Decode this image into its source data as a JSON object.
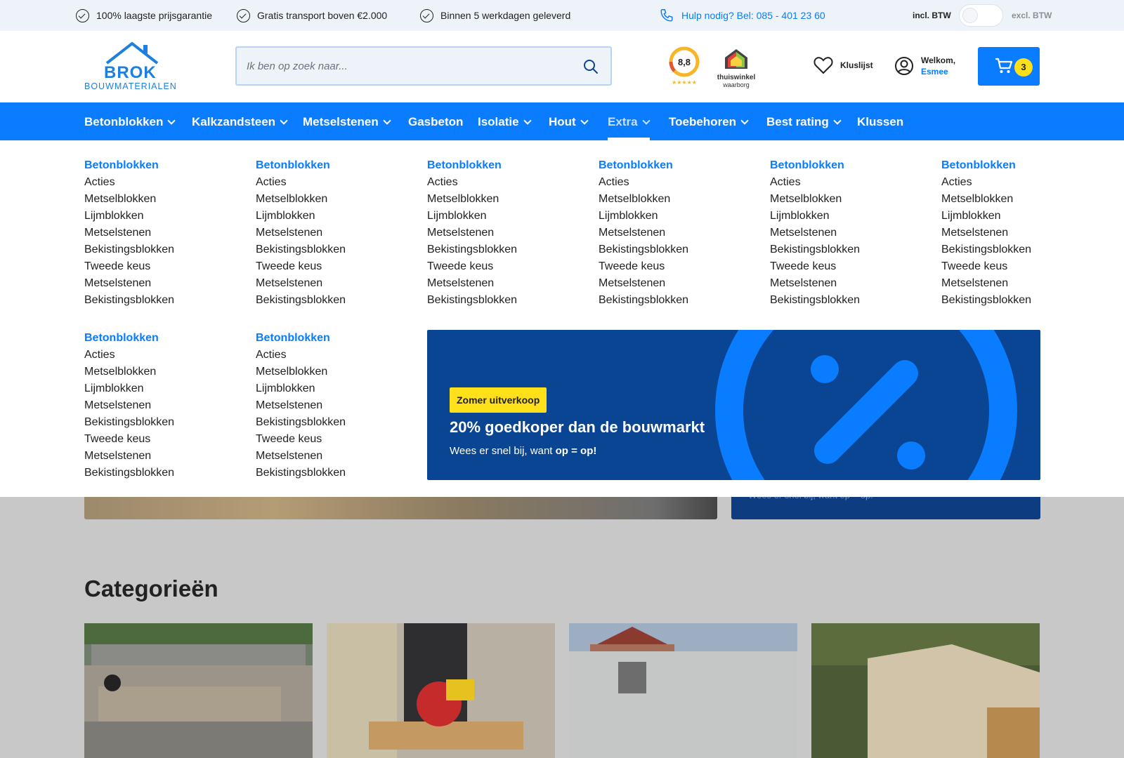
{
  "topbar": {
    "usps": [
      "100% laagste prijsgarantie",
      "Gratis transport boven €2.000",
      "Binnen 5 werkdagen geleverd"
    ],
    "help": "Hulp nodig? Bel: 085 - 401 23 60",
    "incl_btw": "incl. BTW",
    "excl_btw": "excl. BTW"
  },
  "header": {
    "logo_brand": "BROK",
    "logo_sub": "BOUWMATERIALEN",
    "search_placeholder": "Ik ben op zoek naar...",
    "rating": "8,8",
    "thuiswinkel_line1": "thuiswinkel",
    "thuiswinkel_line2": "waarborg",
    "wishlist": "Kluslijst",
    "welcome": "Welkom,",
    "user_name": "Esmee",
    "cart_count": "3"
  },
  "nav": {
    "items": [
      {
        "label": "Betonblokken"
      },
      {
        "label": "Kalkzandsteen"
      },
      {
        "label": "Metselstenen"
      },
      {
        "label": "Gasbeton"
      },
      {
        "label": "Isolatie"
      },
      {
        "label": "Hout"
      },
      {
        "label": "Extra"
      },
      {
        "label": "Toebehoren"
      },
      {
        "label": "Best rating"
      },
      {
        "label": "Klussen"
      }
    ]
  },
  "mega": {
    "column": {
      "head": "Betonblokken",
      "links": [
        "Acties",
        "Metselblokken",
        "Lijmblokken",
        "Metselstenen",
        "Bekistingsblokken",
        "Tweede keus",
        "Metselstenen",
        "Bekistingsblokken"
      ]
    },
    "promo": {
      "badge": "Zomer uitverkoop",
      "title": "20% goedkoper dan de bouwmarkt",
      "text_pre": "Wees er snel bij, want ",
      "text_bold": "op = op!"
    }
  },
  "page": {
    "categories_title": "Categorieën",
    "hero_right_text": "Wees er snel bij, want op = op!"
  },
  "colors": {
    "primary": "#0a7cff",
    "dark_blue": "#0a4593",
    "accent_yellow": "#ffe01b"
  }
}
